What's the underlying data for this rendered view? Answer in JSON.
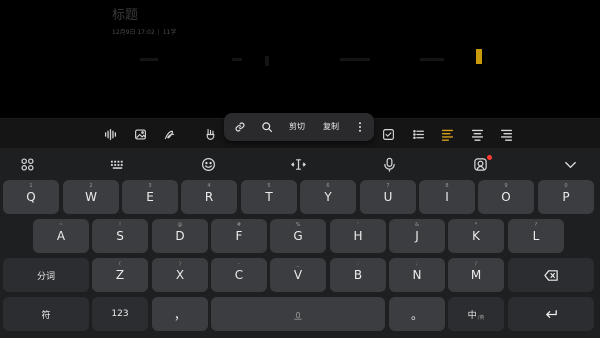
{
  "note": {
    "title": "标题",
    "date": "12月9日 17:02",
    "chars": "11字"
  },
  "toolbar": {
    "icons": [
      "audio-wave-icon",
      "image-icon",
      "handwriting-icon",
      "brush-icon",
      "checkbox-icon",
      "bullet-list-icon",
      "align-left-icon",
      "align-center-icon",
      "align-right-icon"
    ],
    "highlight_color": "#d9a01a"
  },
  "popup": {
    "cut": "剪切",
    "copy": "复制"
  },
  "keyboard": {
    "row1": [
      {
        "main": "Q",
        "sub": "1"
      },
      {
        "main": "W",
        "sub": "2"
      },
      {
        "main": "E",
        "sub": "3"
      },
      {
        "main": "R",
        "sub": "4"
      },
      {
        "main": "T",
        "sub": "5"
      },
      {
        "main": "Y",
        "sub": "6"
      },
      {
        "main": "U",
        "sub": "7"
      },
      {
        "main": "I",
        "sub": "8"
      },
      {
        "main": "O",
        "sub": "9"
      },
      {
        "main": "P",
        "sub": "0"
      }
    ],
    "row2": [
      {
        "main": "A",
        "sub": "~"
      },
      {
        "main": "S",
        "sub": "!"
      },
      {
        "main": "D",
        "sub": "@"
      },
      {
        "main": "F",
        "sub": "#"
      },
      {
        "main": "G",
        "sub": "%"
      },
      {
        "main": "H",
        "sub": "'"
      },
      {
        "main": "J",
        "sub": "&"
      },
      {
        "main": "K",
        "sub": "*"
      },
      {
        "main": "L",
        "sub": "?"
      }
    ],
    "row3": [
      {
        "main": "Z",
        "sub": "("
      },
      {
        "main": "X",
        "sub": ")"
      },
      {
        "main": "C",
        "sub": "-"
      },
      {
        "main": "V",
        "sub": "_"
      },
      {
        "main": "B",
        "sub": ":"
      },
      {
        "main": "N",
        "sub": ";"
      },
      {
        "main": "M",
        "sub": "/"
      }
    ],
    "segment_label": "分词",
    "symbols_label": "符",
    "numbers_label": "123",
    "comma": "，",
    "period": "。",
    "lang_label": "中",
    "lang_mini": "/英"
  }
}
